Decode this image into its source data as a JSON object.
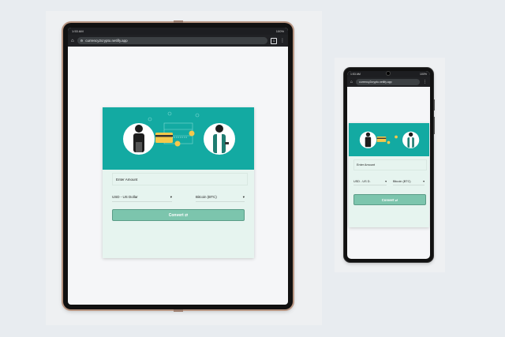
{
  "browser": {
    "time": "1:53 AM",
    "battery": "100%",
    "url": "currency2crypto.netlify.app",
    "tab_count": "1"
  },
  "converter": {
    "amount_placeholder": "Enter Amount",
    "from_currency": "USD - US Dollar",
    "to_currency": "Bitcoin (BTC)",
    "phone_from_currency": "USD - US D.",
    "phone_to_currency": "Bitcoin (BTC)",
    "convert_label": "Convert ⇄"
  },
  "colors": {
    "accent": "#13aaa2",
    "card_bg": "#e6f4ef",
    "button_bg": "#7cc5ad",
    "page_bg": "#f5f6f8"
  }
}
